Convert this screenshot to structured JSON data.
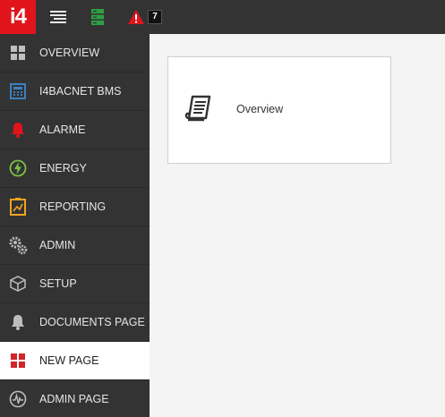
{
  "header": {
    "logo_text": "i4",
    "alarm_count": "7"
  },
  "sidebar": {
    "items": [
      {
        "label": "OVERVIEW"
      },
      {
        "label": "I4BACNET BMS"
      },
      {
        "label": "ALARME"
      },
      {
        "label": "ENERGY"
      },
      {
        "label": "REPORTING"
      },
      {
        "label": "ADMIN"
      },
      {
        "label": "SETUP"
      },
      {
        "label": "DOCUMENTS PAGE"
      },
      {
        "label": "NEW PAGE"
      },
      {
        "label": "ADMIN PAGE"
      }
    ]
  },
  "main": {
    "tiles": [
      {
        "label": "Overview",
        "icon": "document-scroll-icon"
      }
    ]
  },
  "colors": {
    "brand": "#e1141c",
    "topbar": "#333333",
    "sidebar": "#333333",
    "active_item": "#ffffff",
    "alarm_red": "#e1141c",
    "energy_green": "#7cc243",
    "reporting_orange": "#f0a31f"
  }
}
